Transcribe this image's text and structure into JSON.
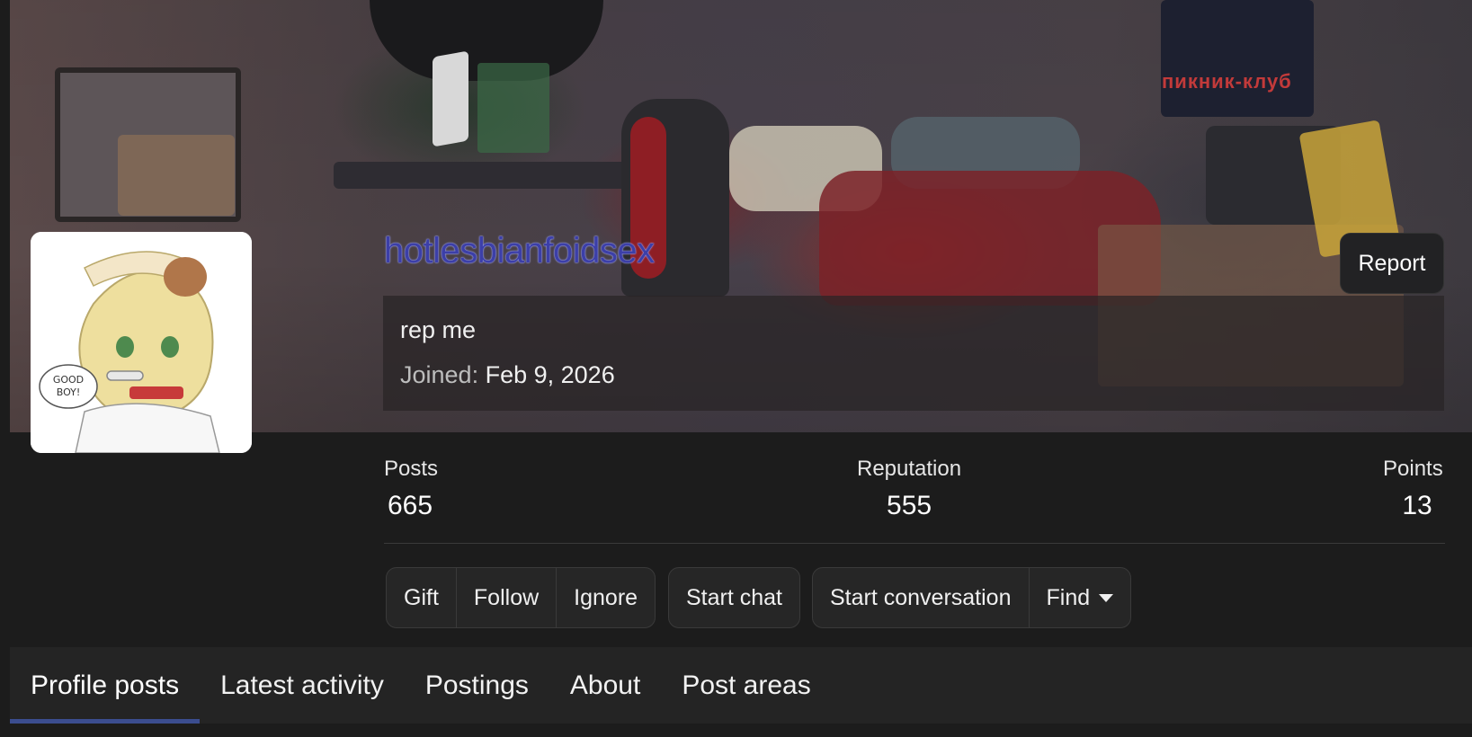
{
  "profile": {
    "username": "hotlesbianfoidsex",
    "status": "rep me",
    "joined_label": "Joined:",
    "joined_date": "Feb 9, 2026",
    "report_label": "Report",
    "avatar_text": "GOOD BOY!"
  },
  "banner": {
    "poster_text": "пикник-клуб"
  },
  "stats": {
    "posts_label": "Posts",
    "posts_value": "665",
    "reputation_label": "Reputation",
    "reputation_value": "555",
    "points_label": "Points",
    "points_value": "13"
  },
  "actions": {
    "gift": "Gift",
    "follow": "Follow",
    "ignore": "Ignore",
    "start_chat": "Start chat",
    "start_conversation": "Start conversation",
    "find": "Find"
  },
  "tabs": [
    {
      "label": "Profile posts",
      "active": true
    },
    {
      "label": "Latest activity",
      "active": false
    },
    {
      "label": "Postings",
      "active": false
    },
    {
      "label": "About",
      "active": false
    },
    {
      "label": "Post areas",
      "active": false
    }
  ],
  "colors": {
    "username": "#3c3fa8",
    "active_tab_underline": "#3b4d8f",
    "background": "#1c1c1c"
  }
}
